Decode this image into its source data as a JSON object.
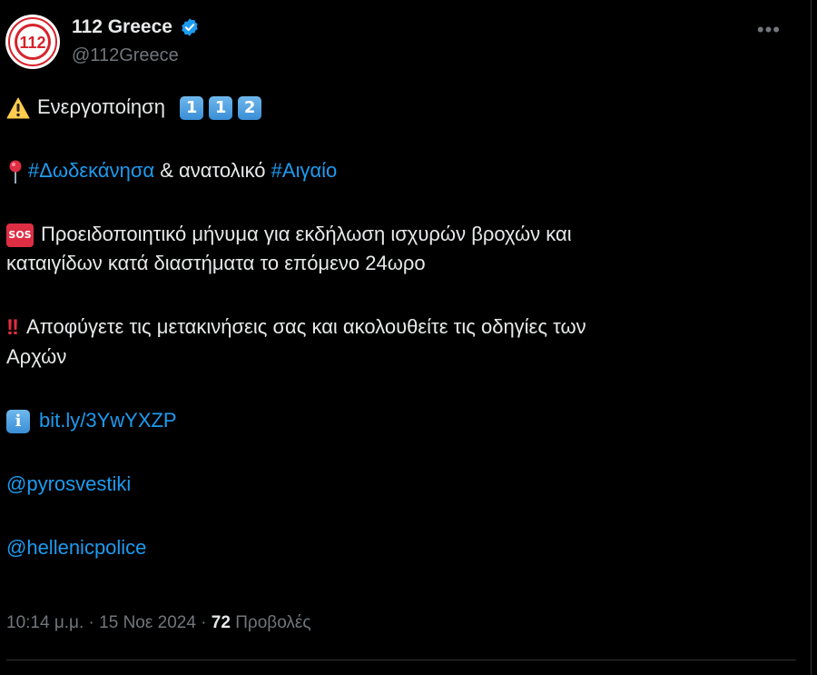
{
  "account": {
    "display_name": "112 Greece",
    "handle": "@112Greece",
    "avatar_text": "112",
    "verified": true
  },
  "more_label": "•••",
  "tweet": {
    "line1_text": "Ενεργοποίηση",
    "keycaps": [
      "1",
      "1",
      "2"
    ],
    "line2_hashtag1": "#Δωδεκάνησα",
    "line2_mid": " & ανατολικό ",
    "line2_hashtag2": "#Αιγαίο",
    "sos_label": "SOS",
    "line3a": "Προειδοποιητικό μήνυμα για εκδήλωση ισχυρών βροχών και",
    "line3b": "καταιγίδων κατά διαστήματα το επόμενο 24ωρο",
    "bang": "!!",
    "line4a": "Αποφύγετε τις μετακινήσεις σας και ακολουθείτε τις οδηγίες των",
    "line4b": "Αρχών",
    "info_label": "i",
    "link": "bit.ly/3YwYXZP",
    "mention1": "@pyrosvestiki",
    "mention2": "@hellenicpolice"
  },
  "meta": {
    "time": "10:14 μ.μ.",
    "sep": " · ",
    "date": "15 Νοε 2024",
    "views_count": "72",
    "views_label": "Προβολές"
  },
  "colors": {
    "background": "#000000",
    "text": "#e7e9ea",
    "muted": "#71767b",
    "link": "#1d9bf0",
    "verified": "#1d9bf0",
    "avatar_red": "#d6232b"
  }
}
